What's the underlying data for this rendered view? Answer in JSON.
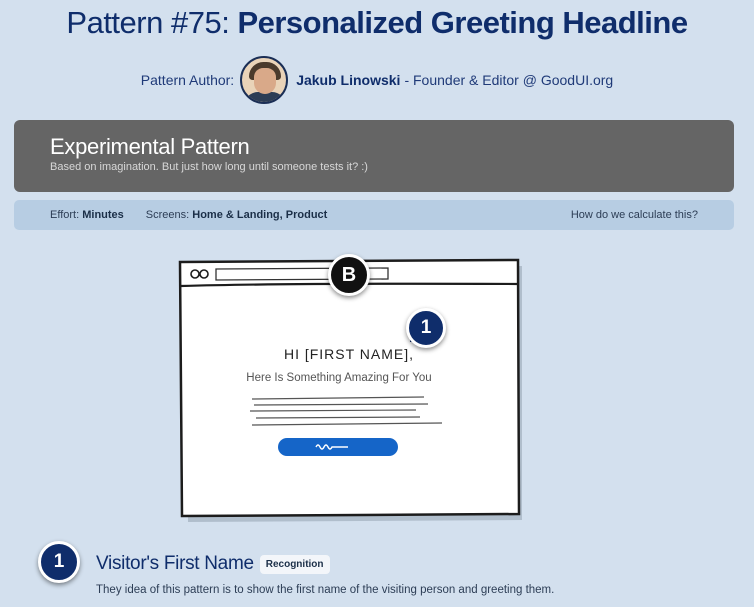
{
  "header": {
    "pattern_number": "Pattern #75:",
    "pattern_name": "Personalized Greeting Headline",
    "author_label": "Pattern Author:",
    "author_name": "Jakub Linowski",
    "author_role": "- Founder & Editor @ GoodUI.org"
  },
  "banner": {
    "heading": "Experimental Pattern",
    "subtext": "Based on imagination. But just how long until someone tests it? :)"
  },
  "meta": {
    "effort_label": "Effort:",
    "effort_value": "Minutes",
    "screens_label": "Screens:",
    "screens_value": "Home & Landing, Product",
    "how_link": "How do we calculate this?"
  },
  "illustration": {
    "variant_badge": "B",
    "marker_number": "1",
    "greeting": "HI [FIRST NAME],",
    "subheading": "Here Is Something Amazing For You",
    "button_scribble": "mwm",
    "button_color": "#1565c8"
  },
  "section": {
    "number": "1",
    "title": "Visitor's First Name",
    "tag": "Recognition",
    "description": "They idea of this pattern is to show the first name of the visiting person and greeting them."
  },
  "colors": {
    "background": "#d3e0ee",
    "navy": "#0f2d6b",
    "banner": "#656565",
    "meta_bar": "#b7cde3"
  }
}
